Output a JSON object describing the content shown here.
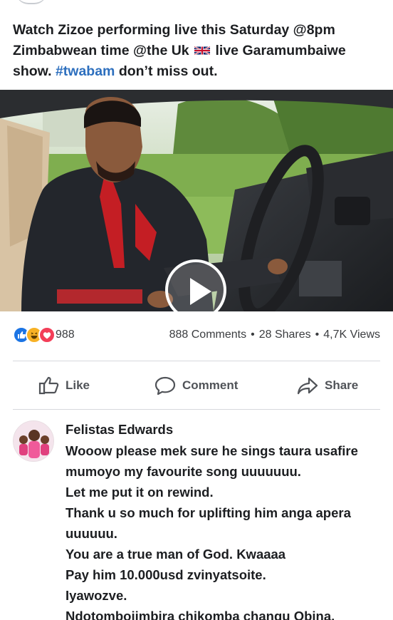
{
  "post": {
    "text_part1": "Watch Zizoe performing live this Saturday @8pm Zimbabwean time @the Uk",
    "text_part2": "live Garamumbaiwe show.",
    "hashtag": "#twabam",
    "text_part3": "don’t miss out.",
    "flag_icon": "uk-flag-emoji"
  },
  "video": {
    "play_icon": "play-icon"
  },
  "stats": {
    "reaction_icons": [
      "like-reaction-icon",
      "haha-reaction-icon",
      "love-reaction-icon"
    ],
    "reaction_count": "988",
    "comments": "888 Comments",
    "shares": "28 Shares",
    "views": "4,7K Views",
    "separator": "•"
  },
  "actions": {
    "like_label": "Like",
    "comment_label": "Comment",
    "share_label": "Share"
  },
  "comment": {
    "author": "Felistas Edwards",
    "lines": [
      "Wooow please mek sure he sings taura usafire",
      "mumoyo my favourite song uuuuuuu.",
      "Let me put it on rewind.",
      "Thank u so much for uplifting him anga apera",
      "uuuuuu.",
      "You are a true man of God. Kwaaaa",
      "Pay him 10.000usd zvinyatsoite.",
      "Iyawozve.",
      "Ndotomboiimbira chikomba changu Obina."
    ]
  },
  "colors": {
    "link_blue": "#2d6fbe",
    "like_blue": "#1b74e4",
    "haha_yellow": "#f7b125",
    "love_red": "#f33e58",
    "text_dark": "#1c1e21",
    "text_muted": "#505358"
  }
}
